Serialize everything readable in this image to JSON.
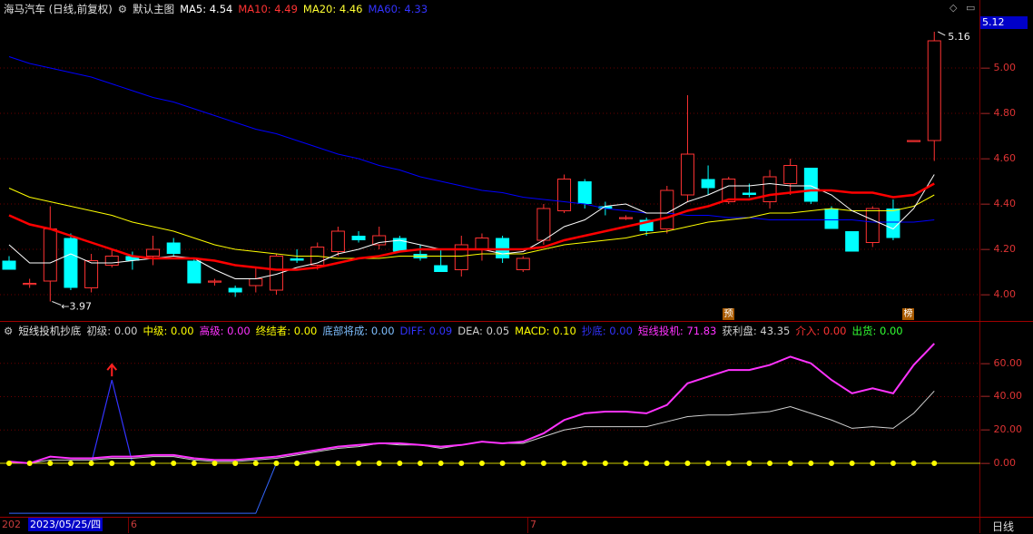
{
  "main_header": {
    "stock_name": "海马汽车 (日线,前复权)",
    "template_name": "默认主图",
    "ma5_label": "MA5: 4.54",
    "ma10_label": "MA10: 4.49",
    "ma20_label": "MA20: 4.46",
    "ma60_label": "MA60: 4.33"
  },
  "price_axis": {
    "current_price_badge": "5.12",
    "ticks": [
      "5.00",
      "4.80",
      "4.60",
      "4.40",
      "4.20",
      "4.00"
    ],
    "high_mark_label": "5.16",
    "low_mark_label": "3.97"
  },
  "indicator_header": {
    "name": "短线投机抄底",
    "items": [
      {
        "text": "初级: 0.00",
        "color": "#d0d0d0"
      },
      {
        "text": "中级: 0.00",
        "color": "#ffff00"
      },
      {
        "text": "高级: 0.00",
        "color": "#ff33ff"
      },
      {
        "text": "终结者: 0.00",
        "color": "#ffff00"
      },
      {
        "text": "底部将成: 0.00",
        "color": "#7fbfff"
      },
      {
        "text": "DIFF: 0.09",
        "color": "#3333ff"
      },
      {
        "text": "DEA: 0.05",
        "color": "#d0d0d0"
      },
      {
        "text": "MACD: 0.10",
        "color": "#ffff00"
      },
      {
        "text": "抄底: 0.00",
        "color": "#3333ff"
      },
      {
        "text": "短线投机: 71.83",
        "color": "#ff33ff"
      },
      {
        "text": "获利盘: 43.35",
        "color": "#d0d0d0"
      },
      {
        "text": "介入: 0.00",
        "color": "#ff3333"
      },
      {
        "text": "出货: 0.00",
        "color": "#33ff33"
      }
    ]
  },
  "indicator_axis": {
    "ticks": [
      "60.00",
      "40.00",
      "20.00",
      "0.00"
    ]
  },
  "date_bar": {
    "left_text": "202",
    "date_label": "2023/05/25/四",
    "tick_6": "6",
    "tick_7": "7"
  },
  "period_label": "日线",
  "event_tags": {
    "tag1": "预",
    "tag2": "榜"
  },
  "colors": {
    "up": "#ff3232",
    "down": "#00ffff",
    "ma5": "#ffffff",
    "ma10": "#ff0000",
    "ma20": "#ffff00",
    "ma60": "#0000ff",
    "grid": "#7a0000"
  },
  "chart_data": {
    "type": "candlestick",
    "candles": [
      {
        "o": 4.15,
        "h": 4.17,
        "l": 4.11,
        "c": 4.11
      },
      {
        "o": 4.05,
        "h": 4.07,
        "l": 4.03,
        "c": 4.05
      },
      {
        "o": 4.06,
        "h": 4.39,
        "l": 3.97,
        "c": 4.29
      },
      {
        "o": 4.25,
        "h": 4.27,
        "l": 4.02,
        "c": 4.03
      },
      {
        "o": 4.03,
        "h": 4.18,
        "l": 4.01,
        "c": 4.15
      },
      {
        "o": 4.13,
        "h": 4.2,
        "l": 4.12,
        "c": 4.17
      },
      {
        "o": 4.17,
        "h": 4.19,
        "l": 4.11,
        "c": 4.15
      },
      {
        "o": 4.17,
        "h": 4.26,
        "l": 4.13,
        "c": 4.2
      },
      {
        "o": 4.23,
        "h": 4.25,
        "l": 4.17,
        "c": 4.18
      },
      {
        "o": 4.15,
        "h": 4.16,
        "l": 4.05,
        "c": 4.05
      },
      {
        "o": 4.06,
        "h": 4.07,
        "l": 4.04,
        "c": 4.06
      },
      {
        "o": 4.03,
        "h": 4.04,
        "l": 3.99,
        "c": 4.01
      },
      {
        "o": 4.04,
        "h": 4.12,
        "l": 4.01,
        "c": 4.07
      },
      {
        "o": 4.02,
        "h": 4.18,
        "l": 4.0,
        "c": 4.17
      },
      {
        "o": 4.16,
        "h": 4.2,
        "l": 4.14,
        "c": 4.15
      },
      {
        "o": 4.13,
        "h": 4.23,
        "l": 4.11,
        "c": 4.21
      },
      {
        "o": 4.19,
        "h": 4.3,
        "l": 4.17,
        "c": 4.28
      },
      {
        "o": 4.26,
        "h": 4.28,
        "l": 4.23,
        "c": 4.24
      },
      {
        "o": 4.22,
        "h": 4.3,
        "l": 4.2,
        "c": 4.26
      },
      {
        "o": 4.25,
        "h": 4.26,
        "l": 4.19,
        "c": 4.19
      },
      {
        "o": 4.18,
        "h": 4.22,
        "l": 4.15,
        "c": 4.16
      },
      {
        "o": 4.13,
        "h": 4.2,
        "l": 4.1,
        "c": 4.1
      },
      {
        "o": 4.11,
        "h": 4.26,
        "l": 4.08,
        "c": 4.22
      },
      {
        "o": 4.2,
        "h": 4.27,
        "l": 4.15,
        "c": 4.25
      },
      {
        "o": 4.25,
        "h": 4.26,
        "l": 4.14,
        "c": 4.16
      },
      {
        "o": 4.11,
        "h": 4.17,
        "l": 4.1,
        "c": 4.16
      },
      {
        "o": 4.24,
        "h": 4.4,
        "l": 4.22,
        "c": 4.38
      },
      {
        "o": 4.37,
        "h": 4.53,
        "l": 4.36,
        "c": 4.51
      },
      {
        "o": 4.5,
        "h": 4.51,
        "l": 4.38,
        "c": 4.4
      },
      {
        "o": 4.39,
        "h": 4.41,
        "l": 4.35,
        "c": 4.38
      },
      {
        "o": 4.34,
        "h": 4.35,
        "l": 4.33,
        "c": 4.34
      },
      {
        "o": 4.33,
        "h": 4.34,
        "l": 4.26,
        "c": 4.28
      },
      {
        "o": 4.29,
        "h": 4.48,
        "l": 4.27,
        "c": 4.46
      },
      {
        "o": 4.44,
        "h": 4.88,
        "l": 4.41,
        "c": 4.62
      },
      {
        "o": 4.51,
        "h": 4.57,
        "l": 4.44,
        "c": 4.47
      },
      {
        "o": 4.41,
        "h": 4.52,
        "l": 4.4,
        "c": 4.51
      },
      {
        "o": 4.45,
        "h": 4.49,
        "l": 4.43,
        "c": 4.44
      },
      {
        "o": 4.41,
        "h": 4.55,
        "l": 4.38,
        "c": 4.52
      },
      {
        "o": 4.49,
        "h": 4.6,
        "l": 4.44,
        "c": 4.57
      },
      {
        "o": 4.56,
        "h": 4.56,
        "l": 4.4,
        "c": 4.41
      },
      {
        "o": 4.38,
        "h": 4.39,
        "l": 4.29,
        "c": 4.29
      },
      {
        "o": 4.28,
        "h": 4.28,
        "l": 4.19,
        "c": 4.19
      },
      {
        "o": 4.23,
        "h": 4.39,
        "l": 4.21,
        "c": 4.38
      },
      {
        "o": 4.38,
        "h": 4.42,
        "l": 4.24,
        "c": 4.25
      },
      {
        "o": 4.68,
        "h": 4.68,
        "l": 4.68,
        "c": 4.68
      },
      {
        "o": 4.68,
        "h": 5.16,
        "l": 4.59,
        "c": 5.12
      }
    ],
    "ma5": [
      4.22,
      4.14,
      4.14,
      4.18,
      4.14,
      4.14,
      4.15,
      4.16,
      4.17,
      4.16,
      4.11,
      4.07,
      4.07,
      4.09,
      4.12,
      4.14,
      4.18,
      4.2,
      4.23,
      4.24,
      4.22,
      4.2,
      4.2,
      4.2,
      4.18,
      4.19,
      4.24,
      4.3,
      4.33,
      4.39,
      4.4,
      4.36,
      4.36,
      4.41,
      4.44,
      4.48,
      4.48,
      4.49,
      4.48,
      4.48,
      4.44,
      4.37,
      4.33,
      4.29,
      4.38,
      4.53
    ],
    "ma10": [
      4.35,
      4.31,
      4.29,
      4.26,
      4.23,
      4.2,
      4.17,
      4.16,
      4.16,
      4.16,
      4.15,
      4.13,
      4.12,
      4.11,
      4.11,
      4.12,
      4.14,
      4.16,
      4.17,
      4.19,
      4.2,
      4.2,
      4.2,
      4.2,
      4.2,
      4.2,
      4.21,
      4.24,
      4.26,
      4.28,
      4.3,
      4.32,
      4.34,
      4.37,
      4.39,
      4.42,
      4.42,
      4.44,
      4.45,
      4.46,
      4.46,
      4.45,
      4.45,
      4.43,
      4.44,
      4.49
    ],
    "ma20": [
      4.47,
      4.43,
      4.41,
      4.39,
      4.37,
      4.35,
      4.32,
      4.3,
      4.28,
      4.25,
      4.22,
      4.2,
      4.19,
      4.18,
      4.17,
      4.17,
      4.16,
      4.16,
      4.16,
      4.17,
      4.17,
      4.17,
      4.17,
      4.18,
      4.18,
      4.18,
      4.2,
      4.22,
      4.23,
      4.24,
      4.25,
      4.27,
      4.28,
      4.3,
      4.32,
      4.33,
      4.34,
      4.36,
      4.36,
      4.37,
      4.38,
      4.37,
      4.37,
      4.37,
      4.39,
      4.44
    ],
    "ma60": [
      5.05,
      5.02,
      5.0,
      4.98,
      4.96,
      4.93,
      4.9,
      4.87,
      4.85,
      4.82,
      4.79,
      4.76,
      4.73,
      4.71,
      4.68,
      4.65,
      4.62,
      4.6,
      4.57,
      4.55,
      4.52,
      4.5,
      4.48,
      4.46,
      4.45,
      4.43,
      4.42,
      4.41,
      4.4,
      4.38,
      4.37,
      4.36,
      4.36,
      4.35,
      4.35,
      4.34,
      4.34,
      4.33,
      4.33,
      4.33,
      4.33,
      4.33,
      4.32,
      4.32,
      4.32,
      4.33
    ],
    "price_ylim": [
      3.92,
      5.22
    ],
    "indicator": {
      "ylim": [
        -31,
        74
      ],
      "short_spec": [
        1,
        0,
        4,
        3,
        3,
        4,
        4,
        5,
        5,
        3,
        2,
        2,
        3,
        4,
        6,
        8,
        10,
        11,
        12,
        12,
        11,
        10,
        11,
        13,
        12,
        13,
        18,
        26,
        30,
        31,
        31,
        30,
        35,
        48,
        52,
        56,
        56,
        59,
        64,
        60,
        50,
        42,
        45,
        42,
        59,
        71.83
      ],
      "profit": [
        1,
        0,
        2,
        2,
        2,
        3,
        3,
        4,
        4,
        2,
        1,
        1,
        2,
        3,
        5,
        7,
        9,
        10,
        12,
        11,
        11,
        9,
        11,
        13,
        12,
        12,
        16,
        20,
        22,
        22,
        22,
        22,
        25,
        28,
        29,
        29,
        30,
        31,
        34,
        30,
        26,
        21,
        22,
        21,
        30,
        43.35
      ],
      "dip": [
        -30,
        -30,
        -30,
        -30,
        -30,
        -30,
        -30,
        -30,
        -30,
        -30,
        -30,
        -30,
        -30,
        0,
        0,
        0,
        0,
        0,
        0,
        0,
        0,
        0,
        0,
        0,
        0,
        0,
        0,
        0,
        0,
        0,
        0,
        0,
        0,
        0,
        0,
        0,
        0,
        0,
        0,
        0,
        0,
        0,
        0,
        0,
        0,
        0
      ],
      "spike": {
        "index": 5,
        "value": 50
      },
      "zero_markers": 46
    }
  }
}
